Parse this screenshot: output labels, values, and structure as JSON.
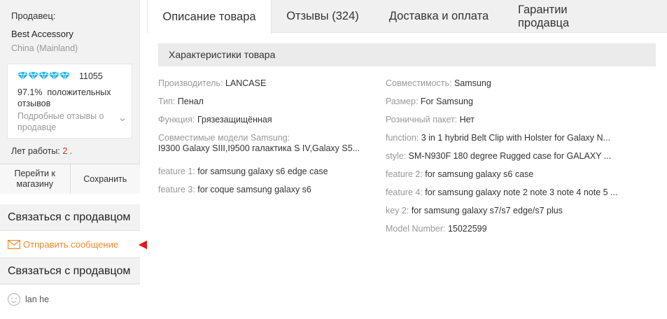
{
  "seller": {
    "label": "Продавец:",
    "name": "Best Accessory",
    "country": "China (Mainland)",
    "rating_count": "11055",
    "positive_pct": "97.1%",
    "positive_text": "положительных отзывов",
    "feedback_link": "Подробные отзывы о продавце",
    "years_label": "Лет работы:",
    "years_value": "2 .",
    "go_to_store": "Перейти к магазину",
    "save": "Сохранить",
    "diamond_color": "#19b3e6"
  },
  "contact": {
    "heading_1": "Связаться с продавцом",
    "send_message": "Отправить сообщение",
    "heading_2": "Связаться с продавцом",
    "person_name": "lan he",
    "message_color": "#f08a2a"
  },
  "tabs": [
    {
      "label": "Описание товара"
    },
    {
      "label": "Отзывы (324)"
    },
    {
      "label": "Доставка и оплата"
    },
    {
      "label": "Гарантии продавца"
    }
  ],
  "specs": {
    "header": "Характеристики товара",
    "left": [
      {
        "k": "Производитель: ",
        "v": "LANCASE"
      },
      {
        "k": "Тип: ",
        "v": "Пенал"
      },
      {
        "k": "Функция: ",
        "v": "Грязезащищённая"
      },
      {
        "k": "Совместимые модели Samsung:",
        "v": "I9300 Galaxy SIII,I9500 галактика S IV,Galaxy S5..."
      },
      {
        "k": "feature 1: ",
        "v": "for samsung galaxy s6 edge case"
      },
      {
        "k": "feature 3: ",
        "v": "for coque samsung galaxy s6"
      }
    ],
    "right": [
      {
        "k": "Совместимость: ",
        "v": "Samsung"
      },
      {
        "k": "Размер: ",
        "v": "For Samsung"
      },
      {
        "k": "Розничный пакет: ",
        "v": "Нет"
      },
      {
        "k": "function: ",
        "v": "3 in 1 hybrid Belt Clip with Holster for Galaxy N..."
      },
      {
        "k": "style: ",
        "v": "SM-N930F 180 degree Rugged case for GALAXY ..."
      },
      {
        "k": "feature 2: ",
        "v": "for samsung galaxy s6 case"
      },
      {
        "k": "feature 4: ",
        "v": "for samsung galaxy note 2 note 3 note 4 note 5 ..."
      },
      {
        "k": "key 2: ",
        "v": "for samsung galaxy s7/s7 edge/s7 plus"
      },
      {
        "k": "Model Number: ",
        "v": "15022599"
      }
    ]
  },
  "colors": {
    "arrow": "#e8141c",
    "years_value": "#e62e04"
  },
  "icons": {
    "rating": "diamond-icon",
    "message": "envelope-icon",
    "person": "smiley-avatar-icon",
    "expand": "chevron-down-icon",
    "pointer": "red-arrow"
  }
}
